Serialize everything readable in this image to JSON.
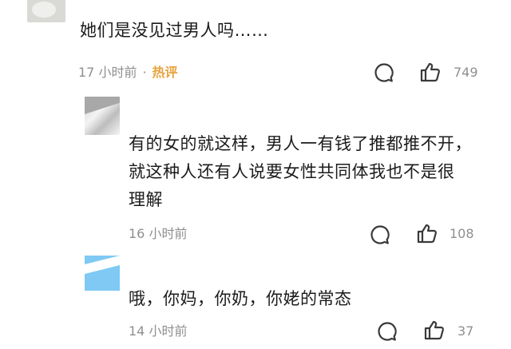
{
  "comments": [
    {
      "text_lines": [
        "她们是没见过男人吗……"
      ],
      "time": "17 小时前",
      "tag": "热评",
      "likes": "749"
    },
    {
      "text_lines": [
        "有的女的就这样，男人一有钱了推都推不开，",
        "就这种人还有人说要女性共同体我也不是很",
        "理解"
      ],
      "time": "16 小时前",
      "likes": "108"
    },
    {
      "text_lines": [
        "哦，你妈，你奶，你姥的常态"
      ],
      "time": "14 小时前",
      "likes": "37"
    }
  ],
  "icons": {
    "reply": "reply-bubble-icon",
    "like": "thumbs-up-icon"
  },
  "colors": {
    "hot_tag": "#e8a23a",
    "meta_text": "#8f8f8f",
    "body_text": "#1b1b1b",
    "icon_stroke": "#3a3a3a"
  }
}
